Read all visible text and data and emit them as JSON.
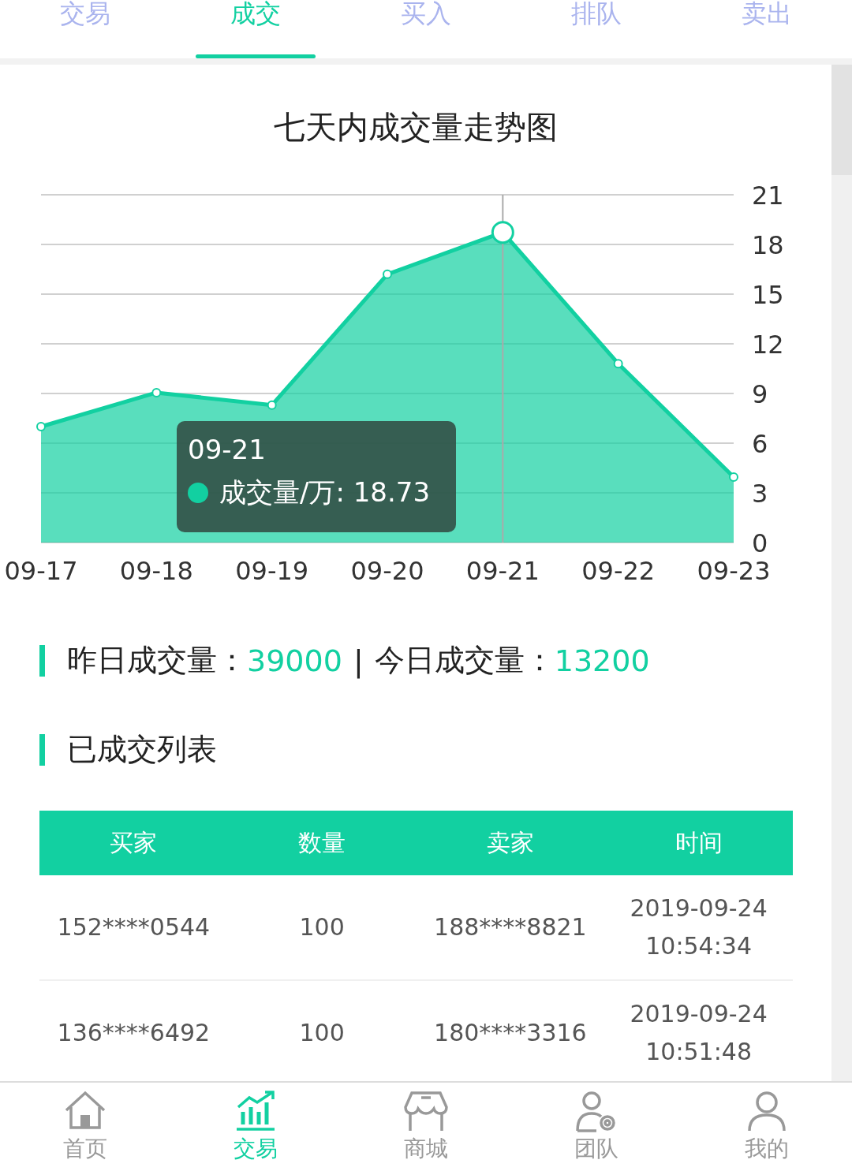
{
  "tabs": [
    {
      "label": "交易",
      "selected": false
    },
    {
      "label": "成交",
      "selected": true
    },
    {
      "label": "买入",
      "selected": false
    },
    {
      "label": "排队",
      "selected": false
    },
    {
      "label": "卖出",
      "selected": false
    }
  ],
  "chart": {
    "chart_data": {
      "type": "area",
      "title": "七天内成交量走势图",
      "categories": [
        "09-17",
        "09-18",
        "09-19",
        "09-20",
        "09-21",
        "09-22",
        "09-23"
      ],
      "series": [
        {
          "name": "成交量/万",
          "color": "#12d0a1",
          "values": [
            7.0,
            9.05,
            8.3,
            16.2,
            18.73,
            10.8,
            3.95
          ]
        }
      ],
      "ylim": [
        0,
        21
      ],
      "yticks": [
        0,
        3,
        6,
        9,
        12,
        15,
        18,
        21
      ],
      "grid": true,
      "ref_lines": [
        {
          "axis": "x",
          "value": "09-21",
          "color": "#aaaaaa"
        }
      ]
    },
    "tooltip": {
      "title": "09-21",
      "value": ": 18.73"
    }
  },
  "stats": {
    "yesterday_label": "昨日成交量：",
    "yesterday_value": "39000",
    "separator": "|",
    "today_label": "今日成交量：",
    "today_value": "13200"
  },
  "list_title": "已成交列表",
  "table": {
    "columns": [
      "买家",
      "数量",
      "卖家",
      "时间"
    ],
    "rows": [
      {
        "buyer": "152****0544",
        "quantity": "100",
        "seller": "188****8821",
        "date": "2019-09-24",
        "time": "10:54:34"
      },
      {
        "buyer": "136****6492",
        "quantity": "100",
        "seller": "180****3316",
        "date": "2019-09-24",
        "time": "10:51:48"
      }
    ]
  },
  "bottom_nav": [
    {
      "label": "首页",
      "selected": false
    },
    {
      "label": "交易",
      "selected": true
    },
    {
      "label": "商城",
      "selected": false
    },
    {
      "label": "团队",
      "selected": false
    },
    {
      "label": "我的",
      "selected": false
    }
  ]
}
